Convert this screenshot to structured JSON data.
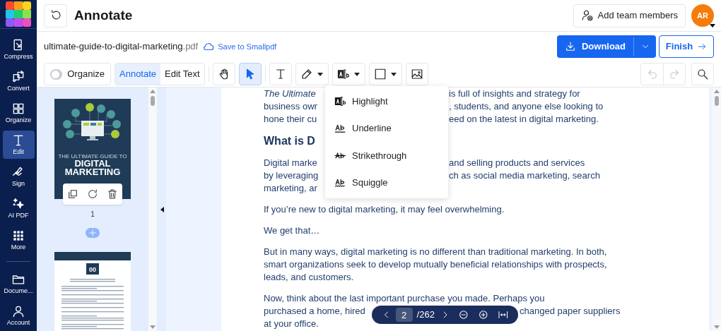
{
  "sidebar": {
    "items": [
      {
        "kind": "compress",
        "label": "Compress",
        "selected": false
      },
      {
        "kind": "convert",
        "label": "Convert",
        "selected": false
      },
      {
        "kind": "organize",
        "label": "Organize",
        "selected": false
      },
      {
        "kind": "edit",
        "label": "Edit",
        "selected": true
      },
      {
        "kind": "sign",
        "label": "Sign",
        "selected": false
      },
      {
        "kind": "ai",
        "label": "AI PDF",
        "selected": false
      },
      {
        "kind": "more",
        "label": "More",
        "selected": false
      },
      {
        "kind": "documents",
        "label": "Docume...",
        "selected": false
      },
      {
        "kind": "account",
        "label": "Account",
        "selected": false
      }
    ]
  },
  "header": {
    "title": "Annotate",
    "team_button": "Add team members",
    "avatar": "AR"
  },
  "file": {
    "name": "ultimate-guide-to-digital-marketing",
    "extension": ".pdf",
    "save_link": "Save to Smallpdf"
  },
  "actions": {
    "download": "Download",
    "finish": "Finish"
  },
  "toolbar": {
    "organize": {
      "label": "Organize",
      "on": false
    },
    "modes": [
      {
        "label": "Annotate",
        "selected": true
      },
      {
        "label": "Edit Text",
        "selected": false
      }
    ],
    "tools": [
      {
        "kind": "hand",
        "selected": false,
        "dropdown": false
      },
      {
        "kind": "pointer",
        "selected": true,
        "dropdown": false
      },
      {
        "kind": "text",
        "selected": false,
        "dropdown": false
      },
      {
        "kind": "pen",
        "selected": false,
        "dropdown": true
      },
      {
        "kind": "highlight",
        "selected": false,
        "dropdown": true
      },
      {
        "kind": "shape",
        "selected": false,
        "dropdown": true
      },
      {
        "kind": "image",
        "selected": false,
        "dropdown": false
      }
    ],
    "history": [
      {
        "kind": "undo",
        "disabled": true
      },
      {
        "kind": "redo",
        "disabled": true
      }
    ]
  },
  "thumbnails": [
    {
      "kind": "cover",
      "page": "1",
      "overline": "THE ULTIMATE GUIDE TO",
      "title_lines": [
        "DIGITAL",
        "MARKETING"
      ]
    },
    {
      "kind": "text_page",
      "chapter": "00"
    }
  ],
  "document": {
    "blocks": [
      {
        "kind": "split_menu",
        "lines": [
          {
            "left": "*The Ultimate*",
            "right": "is full of insights and strategy for"
          },
          {
            "left": "business owr",
            "right": ", students, and anyone else looking to"
          },
          {
            "left": "hone their cu",
            "right": "eed on the latest in digital marketing."
          }
        ]
      },
      {
        "kind": "heading",
        "text": "What is D"
      },
      {
        "kind": "split_menu",
        "lines": [
          {
            "left": "Digital marke",
            "right": "and selling products and services"
          },
          {
            "left": "by leveraging",
            "right": "ch as social media marketing, search"
          },
          {
            "left": "marketing, ar"
          }
        ]
      },
      {
        "kind": "paragraph",
        "text": "If you’re new to digital marketing, it may feel overwhelming."
      },
      {
        "kind": "paragraph",
        "text": "We get that…"
      },
      {
        "kind": "paragraph",
        "text": "But in many ways, digital marketing is no different than traditional marketing. In both, smart organizations seek to develop mutually beneficial relationships with prospects, leads, and customers."
      },
      {
        "kind": "split_nav",
        "lines": [
          {
            "left": "Now, think about the last important purchase you made. Perhaps you"
          },
          {
            "left": "purchased a home, hired",
            "right": "changed paper suppliers"
          },
          {
            "left": "at your office."
          }
        ]
      }
    ]
  },
  "menu": {
    "items": [
      {
        "kind": "highlight",
        "label": "Highlight"
      },
      {
        "kind": "underline",
        "label": "Underline"
      },
      {
        "kind": "strikethrough",
        "label": "Strikethrough"
      },
      {
        "kind": "squiggle",
        "label": "Squiggle"
      }
    ]
  },
  "page_nav": {
    "page": "2",
    "total": "/262"
  }
}
